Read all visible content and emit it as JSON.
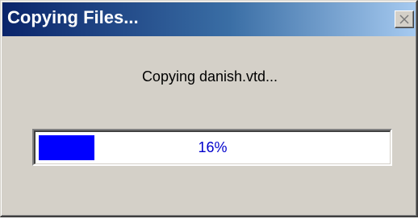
{
  "window": {
    "title": "Copying Files...",
    "close_label": "×"
  },
  "status": {
    "text": "Copying danish.vtd..."
  },
  "progress": {
    "value": 0.16,
    "label": "16%",
    "fill_color": "#0000ff",
    "label_color": "#0000cc"
  },
  "colors": {
    "titlebar_start": "#0a246a",
    "titlebar_end": "#a6caf0",
    "dialog_background": "#d4d0c8"
  },
  "icons": {
    "close": "close-icon"
  }
}
